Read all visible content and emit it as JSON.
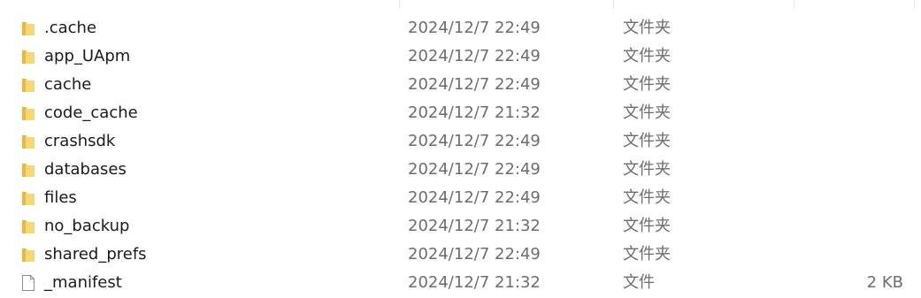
{
  "rows": [
    {
      "name": ".cache",
      "date": "2024/12/7 22:49",
      "type": "文件夹",
      "size": "",
      "icon": "folder-icon"
    },
    {
      "name": "app_UApm",
      "date": "2024/12/7 22:49",
      "type": "文件夹",
      "size": "",
      "icon": "folder-icon"
    },
    {
      "name": "cache",
      "date": "2024/12/7 22:49",
      "type": "文件夹",
      "size": "",
      "icon": "folder-icon"
    },
    {
      "name": "code_cache",
      "date": "2024/12/7 21:32",
      "type": "文件夹",
      "size": "",
      "icon": "folder-icon"
    },
    {
      "name": "crashsdk",
      "date": "2024/12/7 22:49",
      "type": "文件夹",
      "size": "",
      "icon": "folder-icon"
    },
    {
      "name": "databases",
      "date": "2024/12/7 22:49",
      "type": "文件夹",
      "size": "",
      "icon": "folder-icon"
    },
    {
      "name": "files",
      "date": "2024/12/7 22:49",
      "type": "文件夹",
      "size": "",
      "icon": "folder-icon"
    },
    {
      "name": "no_backup",
      "date": "2024/12/7 21:32",
      "type": "文件夹",
      "size": "",
      "icon": "folder-icon"
    },
    {
      "name": "shared_prefs",
      "date": "2024/12/7 22:49",
      "type": "文件夹",
      "size": "",
      "icon": "folder-icon"
    },
    {
      "name": "_manifest",
      "date": "2024/12/7 21:32",
      "type": "文件",
      "size": "2 KB",
      "icon": "file-icon"
    }
  ],
  "colors": {
    "folder": "#f8d775",
    "folder_dark": "#e8b93c",
    "text": "#1b1b1b",
    "secondary_text": "#6d6d6d"
  }
}
